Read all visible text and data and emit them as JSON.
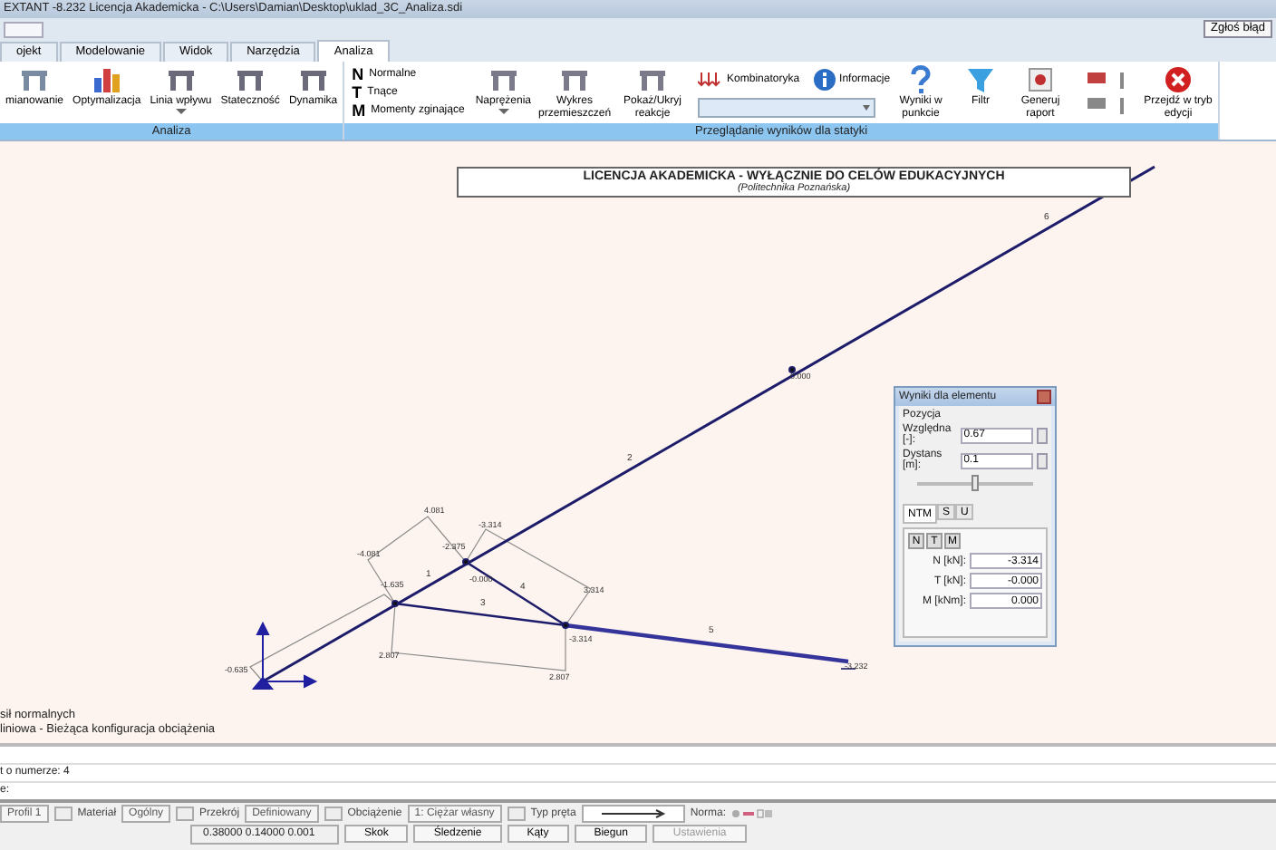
{
  "window": {
    "title": "EXTANT -8.232 Licencja Akademicka - C:\\Users\\Damian\\Desktop\\uklad_3C_Analiza.sdi"
  },
  "quick_access": {
    "report_button": "Zgłoś błąd"
  },
  "tabs": [
    {
      "label": "ojekt",
      "selected": false
    },
    {
      "label": "Modelowanie",
      "selected": false
    },
    {
      "label": "Widok",
      "selected": false
    },
    {
      "label": "Narzędzia",
      "selected": false
    },
    {
      "label": "Analiza",
      "selected": true
    }
  ],
  "ribbon": {
    "groups": [
      {
        "label": "Analiza",
        "items": [
          {
            "kind": "large",
            "label": "mianowanie",
            "dropdown": false
          },
          {
            "kind": "large",
            "label": "Optymalizacja",
            "dropdown": false
          },
          {
            "kind": "large",
            "label": "Linia wpływu",
            "dropdown": true
          },
          {
            "kind": "large",
            "label": "Stateczność",
            "dropdown": false
          },
          {
            "kind": "large",
            "label": "Dynamika",
            "dropdown": false
          }
        ]
      },
      {
        "label": "Przeglądanie wyników dla statyki",
        "items": [
          {
            "kind": "list",
            "entries": [
              {
                "key": "N",
                "label": "Normalne"
              },
              {
                "key": "T",
                "label": "Tnące"
              },
              {
                "key": "M",
                "label": "Momenty zginające"
              }
            ]
          },
          {
            "kind": "large",
            "label": "Naprężenia",
            "dropdown": true
          },
          {
            "kind": "large",
            "label": "Wykres przemieszczeń",
            "dropdown": false
          },
          {
            "kind": "large",
            "label": "Pokaż/Ukryj reakcje",
            "dropdown": false
          },
          {
            "kind": "combo",
            "buttons": [
              "Kombinatoryka",
              "Informacje"
            ]
          },
          {
            "kind": "large",
            "label": "Wyniki w punkcie",
            "dropdown": false
          },
          {
            "kind": "large",
            "label": "Filtr",
            "dropdown": false
          },
          {
            "kind": "large",
            "label": "Generuj raport",
            "dropdown": false
          },
          {
            "kind": "icons"
          },
          {
            "kind": "large",
            "label": "Przejdź w tryb edycji",
            "dropdown": false
          }
        ]
      }
    ]
  },
  "canvas": {
    "banner": {
      "title": "LICENCJA AKADEMICKA - WYŁĄCZNIE DO CELÓW EDUKACYJNYCH",
      "subtitle": "(Politechnika Poznańska)"
    },
    "member_numbers": [
      "1",
      "2",
      "3",
      "4",
      "5",
      "6"
    ],
    "diagram_values": [
      "-0.635",
      "-1.635",
      "-4.081",
      "4.081",
      "-2.375",
      "-3.314",
      "-0.000",
      "3.314",
      "-3.314",
      "2.807",
      "2.807",
      "-3.232",
      "0.000"
    ],
    "notes": [
      "sił normalnych",
      "liniowa - Bieżąca konfiguracja obciążenia"
    ]
  },
  "results_panel": {
    "title": "Wyniki dla elementu",
    "section": "Pozycja",
    "relative": {
      "label": "Względna [-]:",
      "value": "0.67"
    },
    "distance": {
      "label": "Dystans [m]:",
      "value": "0.1"
    },
    "slider": {
      "level": 0.5
    },
    "tabs": [
      {
        "label": "NTM",
        "selected": true
      },
      {
        "label": "S",
        "selected": false
      },
      {
        "label": "U",
        "selected": false
      }
    ],
    "toggles": [
      "N",
      "T",
      "M"
    ],
    "results": [
      {
        "label": "N [kN]:",
        "value": "-3.314"
      },
      {
        "label": "T [kN]:",
        "value": "-0.000"
      },
      {
        "label": "M [kNm]:",
        "value": "0.000"
      }
    ]
  },
  "command_area": {
    "lines": [
      "t o numerze: 4",
      "e:"
    ]
  },
  "property_bar": [
    {
      "kind": "field",
      "value": "Profil 1"
    },
    {
      "kind": "labeled",
      "label": "Materiał",
      "value": "Ogólny"
    },
    {
      "kind": "labeled",
      "label": "Przekrój",
      "value": "Definiowany"
    },
    {
      "kind": "labeled",
      "label": "Obciążenie",
      "value": "1: Ciężar własny"
    },
    {
      "kind": "arrow",
      "label": "Typ pręta"
    },
    {
      "kind": "norm",
      "label": "Norma:"
    }
  ],
  "status_bar": {
    "coordinates": "0.38000  0.14000  0.001",
    "toggles": [
      {
        "label": "Skok",
        "disabled": false
      },
      {
        "label": "Śledzenie",
        "disabled": false
      },
      {
        "label": "Kąty",
        "disabled": false
      },
      {
        "label": "Biegun",
        "disabled": false
      },
      {
        "label": "Ustawienia",
        "disabled": true
      }
    ]
  }
}
